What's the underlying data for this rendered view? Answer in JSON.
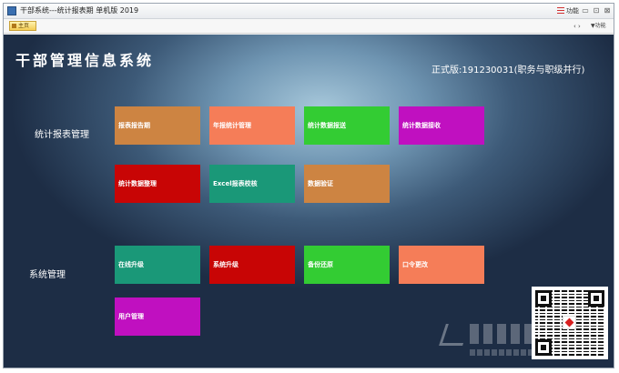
{
  "window": {
    "title": "干部系统---统计报表期 单机版  2019",
    "menu_label": "功能",
    "minimize": "▭",
    "restore": "⊡",
    "close": "⊠"
  },
  "toolbar": {
    "home_label": "主页",
    "nav_arrows": "‹  ›",
    "func_label": "▼功能"
  },
  "header": {
    "system_title": "干部管理信息系统",
    "version": "正式版:191230031(职务与职级并行)"
  },
  "sections": {
    "stats": {
      "label": "统计报表管理"
    },
    "system": {
      "label": "系统管理"
    }
  },
  "tiles": [
    {
      "label": "报表报告期",
      "color": "#cd8442"
    },
    {
      "label": "年报统计管理",
      "color": "#f57d58"
    },
    {
      "label": "统计数据报送",
      "color": "#33cc33"
    },
    {
      "label": "统计数据接收",
      "color": "#c010c0"
    },
    {
      "label": "统计数据整理",
      "color": "#c80505"
    },
    {
      "label": "Excel报表校核",
      "color": "#1a9878"
    },
    {
      "label": "数据验证",
      "color": "#cd8442"
    },
    {
      "label": "在线升级",
      "color": "#1a9878"
    },
    {
      "label": "系统升级",
      "color": "#c80505"
    },
    {
      "label": "备份还原",
      "color": "#33cc33"
    },
    {
      "label": "口令更改",
      "color": "#f57d58"
    },
    {
      "label": "用户管理",
      "color": "#c010c0"
    }
  ],
  "icons": {
    "app": "app-icon",
    "home": "home-icon",
    "menu": "menu-icon",
    "qr": "qr-code-icon"
  }
}
